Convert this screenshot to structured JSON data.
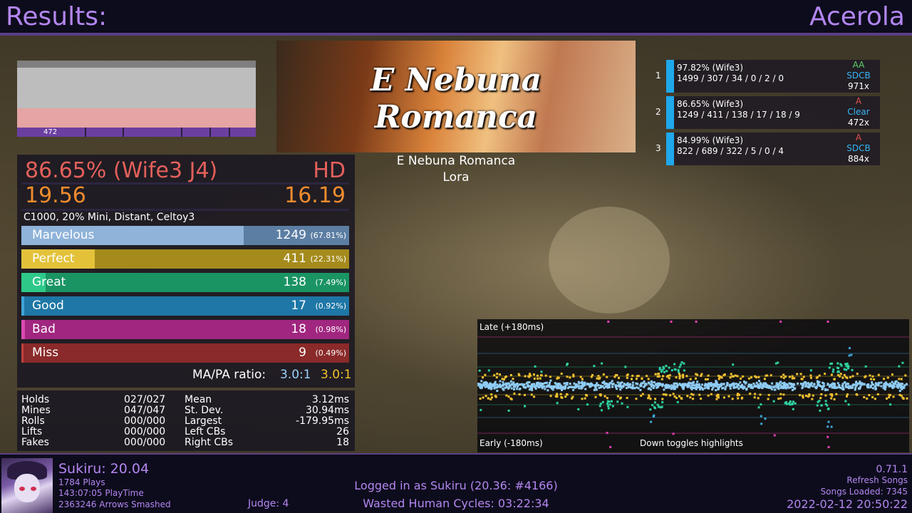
{
  "header": {
    "title": "Results:",
    "theme": "Acerola"
  },
  "lifegraph": {
    "progress_label": "472",
    "progress_segments": 5
  },
  "banner": {
    "line1": "E Nebuna",
    "line2": "Romanca"
  },
  "song": {
    "title": "E Nebuna Romanca",
    "artist": "Lora"
  },
  "score": {
    "wife": "86.65% (Wife3 J4)",
    "grade": "HD",
    "msd_left": "19.56",
    "msd_right": "16.19",
    "modifiers": "C1000, 20% Mini, Distant, Celtoy3"
  },
  "judgments": [
    {
      "name": "Marvelous",
      "count": "1249",
      "pct": "(67.81%)",
      "fraction": 0.6781,
      "color": "#8fb3d9",
      "bg": "#5c7ea3"
    },
    {
      "name": "Perfect",
      "count": "411",
      "pct": "(22.31%)",
      "fraction": 0.2231,
      "color": "#e3c23a",
      "bg": "#a58b1c"
    },
    {
      "name": "Great",
      "count": "138",
      "pct": "(7.49%)",
      "fraction": 0.0749,
      "color": "#2ec98a",
      "bg": "#1a9463"
    },
    {
      "name": "Good",
      "count": "17",
      "pct": "(0.92%)",
      "fraction": 0.0092,
      "color": "#3fa5d8",
      "bg": "#1e77a6"
    },
    {
      "name": "Bad",
      "count": "18",
      "pct": "(0.98%)",
      "fraction": 0.0098,
      "color": "#d94ab0",
      "bg": "#a0267f"
    },
    {
      "name": "Miss",
      "count": "9",
      "pct": "(0.49%)",
      "fraction": 0.0049,
      "color": "#c04040",
      "bg": "#8a2a2a"
    }
  ],
  "mapa": {
    "label": "MA/PA ratio:",
    "ma": "3.0:1",
    "pa": "3.0:1"
  },
  "radar": [
    {
      "label": "Holds",
      "value": "027/027"
    },
    {
      "label": "Mines",
      "value": "047/047"
    },
    {
      "label": "Rolls",
      "value": "000/000"
    },
    {
      "label": "Lifts",
      "value": "000/000"
    },
    {
      "label": "Fakes",
      "value": "000/000"
    }
  ],
  "offset_stats": [
    {
      "label": "Mean",
      "value": "3.12ms"
    },
    {
      "label": "St. Dev.",
      "value": "30.94ms"
    },
    {
      "label": "Largest",
      "value": "-179.95ms"
    },
    {
      "label": "Left CBs",
      "value": "26"
    },
    {
      "label": "Right CBs",
      "value": "18"
    }
  ],
  "scoreboard": [
    {
      "rank": "1",
      "line1": "97.82% (Wife3)",
      "line2": "1499 / 307 / 34 / 0 / 2 / 0",
      "grade": "AA",
      "grade_color": "#5ed16b",
      "lamp": "SDCB",
      "combo": "971x"
    },
    {
      "rank": "2",
      "line1": "86.65% (Wife3)",
      "line2": "1249 / 411 / 138 / 17 / 18 / 9",
      "grade": "A",
      "grade_color": "#e35050",
      "lamp": "Clear",
      "combo": "472x"
    },
    {
      "rank": "3",
      "line1": "84.99% (Wife3)",
      "line2": "822 / 689 / 322 / 5 / 0 / 4",
      "grade": "A",
      "grade_color": "#e35050",
      "lamp": "SDCB",
      "combo": "884x"
    }
  ],
  "offset_plot": {
    "late_label": "Late (+180ms)",
    "early_label": "Early (-180ms)",
    "hint": "Down toggles highlights",
    "colors": {
      "marvelous": "#8fcdf5",
      "perfect": "#f0c030",
      "great": "#2ed1a0",
      "good": "#3fa5d8",
      "bad": "#e040b0"
    }
  },
  "footer": {
    "profile_name": "Sukiru: 20.04",
    "plays": "1784 Plays",
    "playtime": "143:07:05 PlayTime",
    "arrows": "2363246 Arrows Smashed",
    "judge": "Judge: 4",
    "logged_in": "Logged in as Sukiru (20.36: #4166)",
    "wasted": "Wasted Human Cycles: 03:22:34",
    "version": "0.71.1",
    "refresh": "Refresh Songs",
    "songs_loaded": "Songs Loaded: 7345",
    "clock": "2022-02-12 20:50:22"
  }
}
